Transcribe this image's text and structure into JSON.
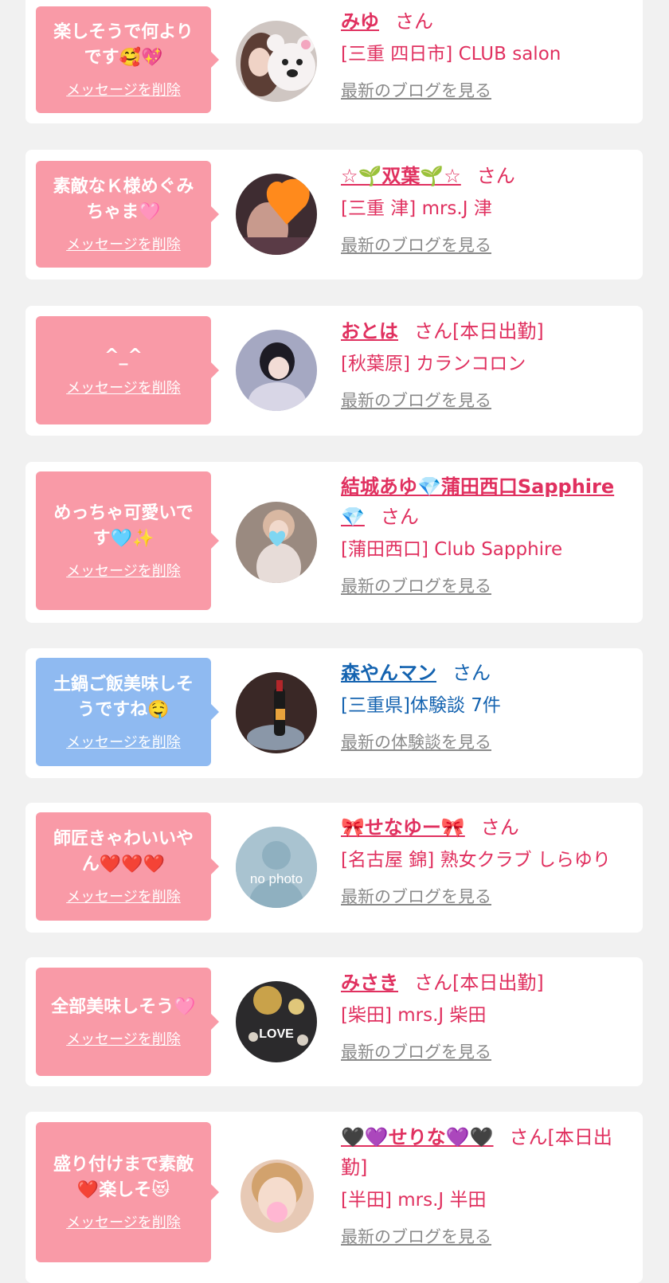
{
  "colors": {
    "bubble_pink": "#f99aa7",
    "bubble_blue": "#8fbaf1",
    "text_pink": "#e0305f",
    "text_blue": "#1463b0",
    "link_gray": "#8a8a8a",
    "background": "#f1f1f1"
  },
  "cards": [
    {
      "message": "楽しそうで何より\nです🥰💖",
      "delete_label": "メッセージを削除",
      "name": "みゆ",
      "suffix": "さん",
      "shop": "[三重 四日市] CLUB salon",
      "link": "最新のブログを見る",
      "theme": "pink"
    },
    {
      "message": "素敵なＫ様めぐみ\nちゃま🩷",
      "delete_label": "メッセージを削除",
      "name": "☆🌱双葉🌱☆",
      "suffix": "さん",
      "shop": "[三重 津] mrs.J 津",
      "link": "最新のブログを見る",
      "theme": "pink"
    },
    {
      "message": "^_^",
      "delete_label": "メッセージを削除",
      "name": "おとは",
      "suffix": "さん[本日出勤]",
      "shop": "[秋葉原] カランコロン",
      "link": "最新のブログを見る",
      "theme": "pink"
    },
    {
      "message": "めっちゃ可愛いで\nす🩵✨",
      "delete_label": "メッセージを削除",
      "name": "結城あゆ💎蒲田西口Sapphire💎",
      "suffix": "さん",
      "shop": "[蒲田西口] Club Sapphire",
      "link": "最新のブログを見る",
      "theme": "pink"
    },
    {
      "message": "土鍋ご飯美味しそ\nうですね🤤",
      "delete_label": "メッセージを削除",
      "name": "森やんマン",
      "suffix": "さん",
      "shop": "[三重県]体験談 7件",
      "link": "最新の体験談を見る",
      "theme": "blue"
    },
    {
      "message": "師匠きゃわいいや\nん❤️❤️❤️",
      "delete_label": "メッセージを削除",
      "name": "🎀せなゆー🎀",
      "suffix": "さん",
      "shop": "[名古屋 錦] 熟女クラブ しらゆり",
      "link": "最新のブログを見る",
      "theme": "pink",
      "avatar_text": "no photo"
    },
    {
      "message": "全部美味しそう🩷",
      "delete_label": "メッセージを削除",
      "name": "みさき",
      "suffix": "さん[本日出勤]",
      "shop": "[柴田] mrs.J 柴田",
      "link": "最新のブログを見る",
      "theme": "pink",
      "avatar_text": "LOVE"
    },
    {
      "message": "盛り付けまで素敵\n❤️楽しそ😻",
      "delete_label": "メッセージを削除",
      "name": "🖤💜せりな💜🖤",
      "suffix": "さん[本日出勤]",
      "shop": "[半田] mrs.J 半田",
      "link": "最新のブログを見る",
      "theme": "pink"
    }
  ]
}
